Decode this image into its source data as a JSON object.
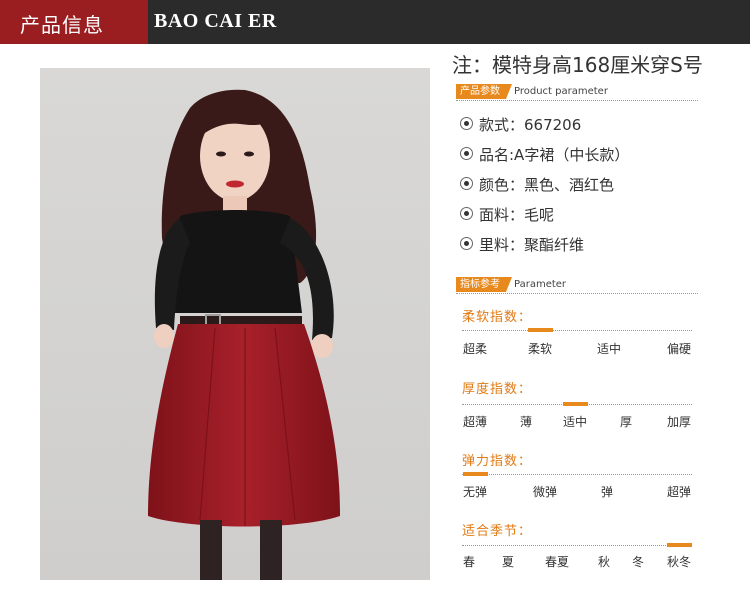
{
  "header": {
    "title": "产品信息",
    "brand": "BAO CAI ER"
  },
  "note": "注：模特身高168厘米穿S号",
  "product_parameter": {
    "tag": "产品参数",
    "label": "Product parameter",
    "items": [
      "款式：667206",
      "品名:A字裙（中长款）",
      "颜色：黑色、酒红色",
      "面料：毛呢",
      "里料：聚酯纤维"
    ]
  },
  "parameter": {
    "tag": "指标参考",
    "label": "Parameter",
    "groups": [
      {
        "title": "柔软指数：",
        "options": [
          "超柔",
          "柔软",
          "适中",
          "偏硬"
        ],
        "selected": "柔软"
      },
      {
        "title": "厚度指数：",
        "options": [
          "超薄",
          "薄",
          "适中",
          "厚",
          "加厚"
        ],
        "selected": "适中"
      },
      {
        "title": "弹力指数：",
        "options": [
          "无弹",
          "微弹",
          "弹",
          "超弹"
        ],
        "selected": "无弹"
      },
      {
        "title": "适合季节：",
        "options": [
          "春",
          "夏",
          "春夏",
          "秋",
          "冬",
          "秋冬"
        ],
        "selected": "秋冬"
      }
    ]
  },
  "colors": {
    "header_red": "#9a1d20",
    "header_dark": "#2b2b2b",
    "accent_orange": "#e8891e",
    "skirt": "#9b1a24"
  }
}
